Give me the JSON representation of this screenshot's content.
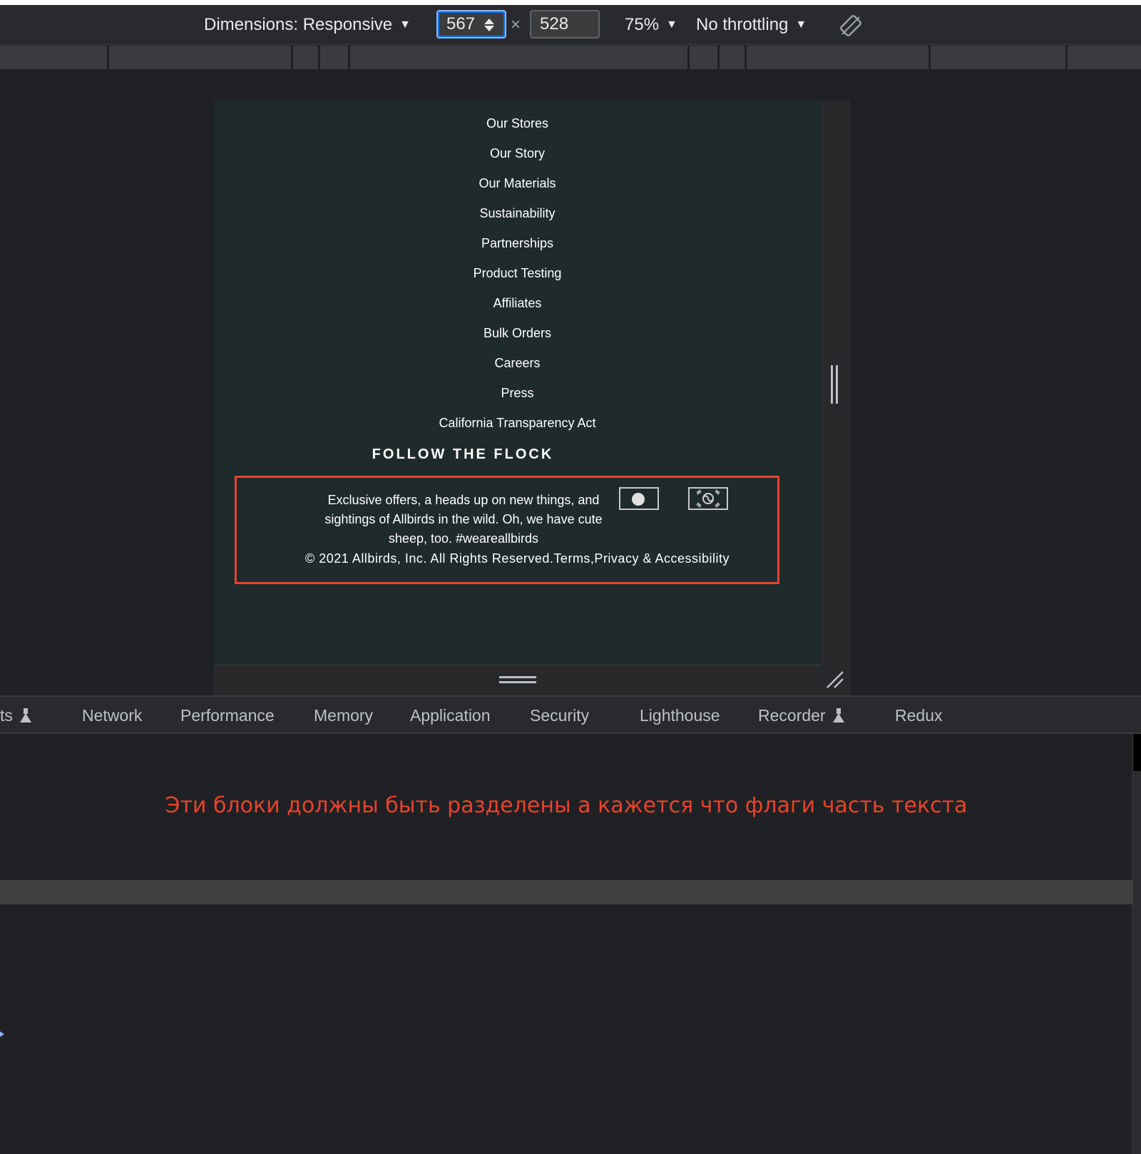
{
  "toolbar": {
    "dimensions_label": "Dimensions: Responsive",
    "width_value": "567",
    "height_value": "528",
    "times": "×",
    "zoom": "75%",
    "throttling": "No throttling",
    "dropdown_glyph": "▼"
  },
  "page": {
    "links": [
      "Our Stores",
      "Our Story",
      "Our Materials",
      "Sustainability",
      "Partnerships",
      "Product Testing",
      "Affiliates",
      "Bulk Orders",
      "Careers",
      "Press",
      "California Transparency Act"
    ],
    "follow_title": "FOLLOW THE FLOCK",
    "blurb": "Exclusive offers, a heads up on new things, and sightings of Allbirds in the wild. Oh, we have cute sheep, too. #weareallbirds",
    "copyright": "© 2021 Allbirds, Inc. All Rights Reserved.Terms,Privacy & Accessibility",
    "flags": [
      "japan-flag-icon",
      "korea-flag-icon"
    ]
  },
  "tabs": {
    "partial": "ts",
    "network": "Network",
    "performance": "Performance",
    "memory": "Memory",
    "application": "Application",
    "security": "Security",
    "lighthouse": "Lighthouse",
    "recorder": "Recorder",
    "redux": "Redux"
  },
  "annotation": "Эти блоки должны быть разделены а кажется что флаги часть текста",
  "colors": {
    "annotation_red": "#e8432b",
    "page_bg": "#1f2a2b",
    "devtools_bg": "#202124",
    "focus_blue": "#8ab4f8"
  }
}
